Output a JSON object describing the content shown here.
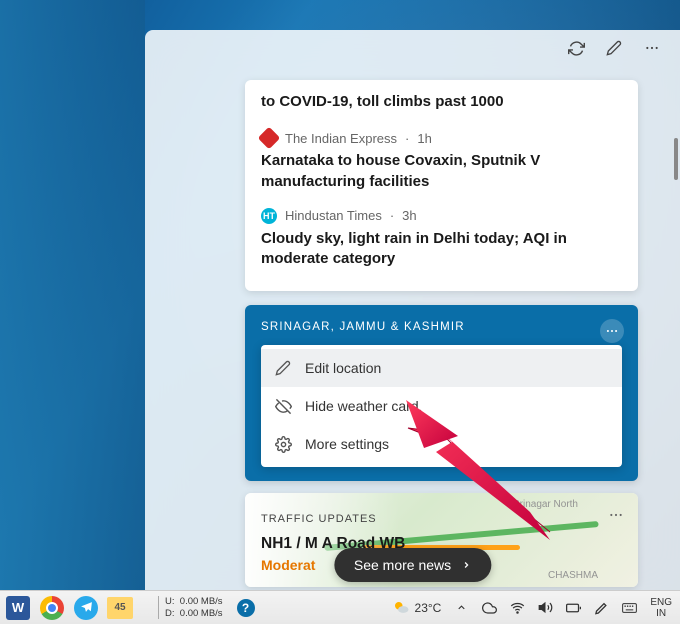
{
  "panel": {
    "news": {
      "headline0": "to COVID-19, toll climbs past 1000",
      "item1": {
        "source": "The Indian Express",
        "time": "1h",
        "headline": "Karnataka to house Covaxin, Sputnik V manufacturing facilities"
      },
      "item2": {
        "source": "Hindustan Times",
        "time": "3h",
        "headline": "Cloudy sky, light rain in Delhi today; AQI in moderate category"
      }
    },
    "weather": {
      "location": "SRINAGAR, JAMMU & KASHMIR",
      "menu": {
        "edit": "Edit location",
        "hide": "Hide weather card",
        "more": "More settings"
      }
    },
    "traffic": {
      "title": "TRAFFIC UPDATES",
      "road": "NH1 / M A Road WB",
      "status": "Moderat",
      "map_labels": {
        "north": "Srinagar North",
        "area": "CHASHMA"
      }
    },
    "see_more": "See more news"
  },
  "taskbar": {
    "folder_badge": "45",
    "netspeed": {
      "up_label": "U:",
      "up_val": "0.00 MB/s",
      "down_label": "D:",
      "down_val": "0.00 MB/s"
    },
    "weather_temp": "23°C",
    "lang": {
      "line1": "ENG",
      "line2": "IN"
    }
  }
}
